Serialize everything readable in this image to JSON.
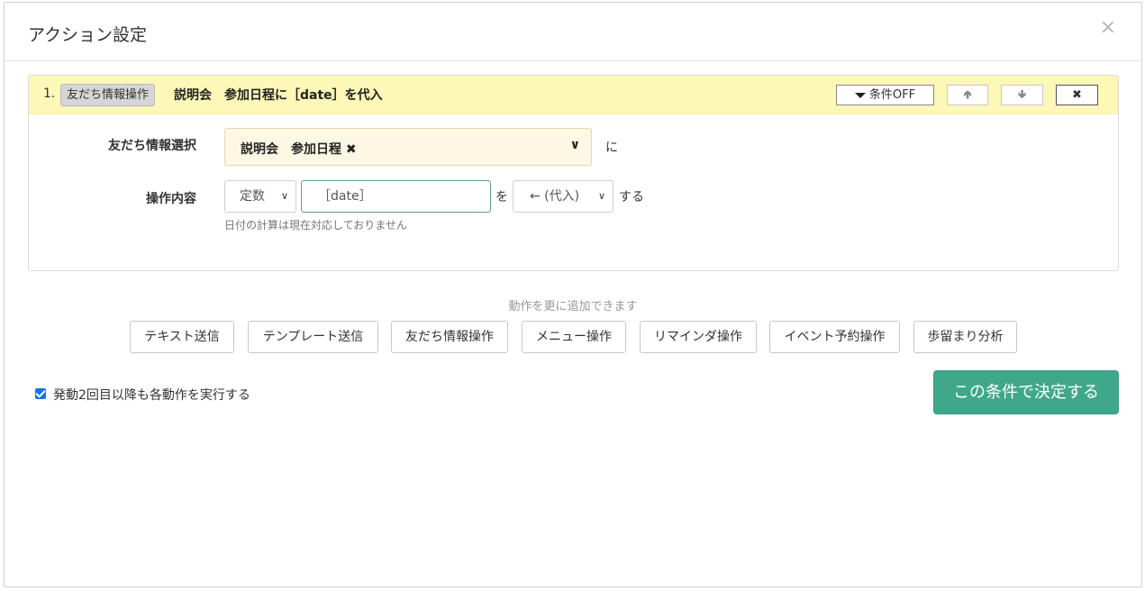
{
  "modal": {
    "title": "アクション設定",
    "close": "×"
  },
  "action": {
    "number": "1.",
    "type_label": "友だち情報操作",
    "description": "説明会　参加日程に［date］を代入",
    "filter_button": "条件OFF",
    "up_icon": "arrow-up-icon",
    "down_icon": "arrow-down-icon",
    "delete_icon": "close-icon"
  },
  "form": {
    "friend_label": "友だち情報選択",
    "friend_value": "説明会　参加日程 ✖",
    "friend_suffix": "に",
    "op_label": "操作内容",
    "op_type": "定数",
    "op_value": "［date］",
    "op_mid": "を",
    "op_mode": "← (代入)",
    "op_suffix": "する",
    "help": "日付の計算は現在対応しておりません"
  },
  "add": {
    "caption": "動作を更に追加できます",
    "buttons": [
      "テキスト送信",
      "テンプレート送信",
      "友だち情報操作",
      "メニュー操作",
      "リマインダ操作",
      "イベント予約操作",
      "歩留まり分析"
    ]
  },
  "repeat": {
    "checked": true,
    "label": "発動2回目以降も各動作を実行する"
  },
  "submit": {
    "label": "この条件で決定する"
  },
  "colors": {
    "header_bg": "#fdf7b8",
    "submit_bg": "#3fa88a",
    "input_border": "#5ea37a"
  }
}
